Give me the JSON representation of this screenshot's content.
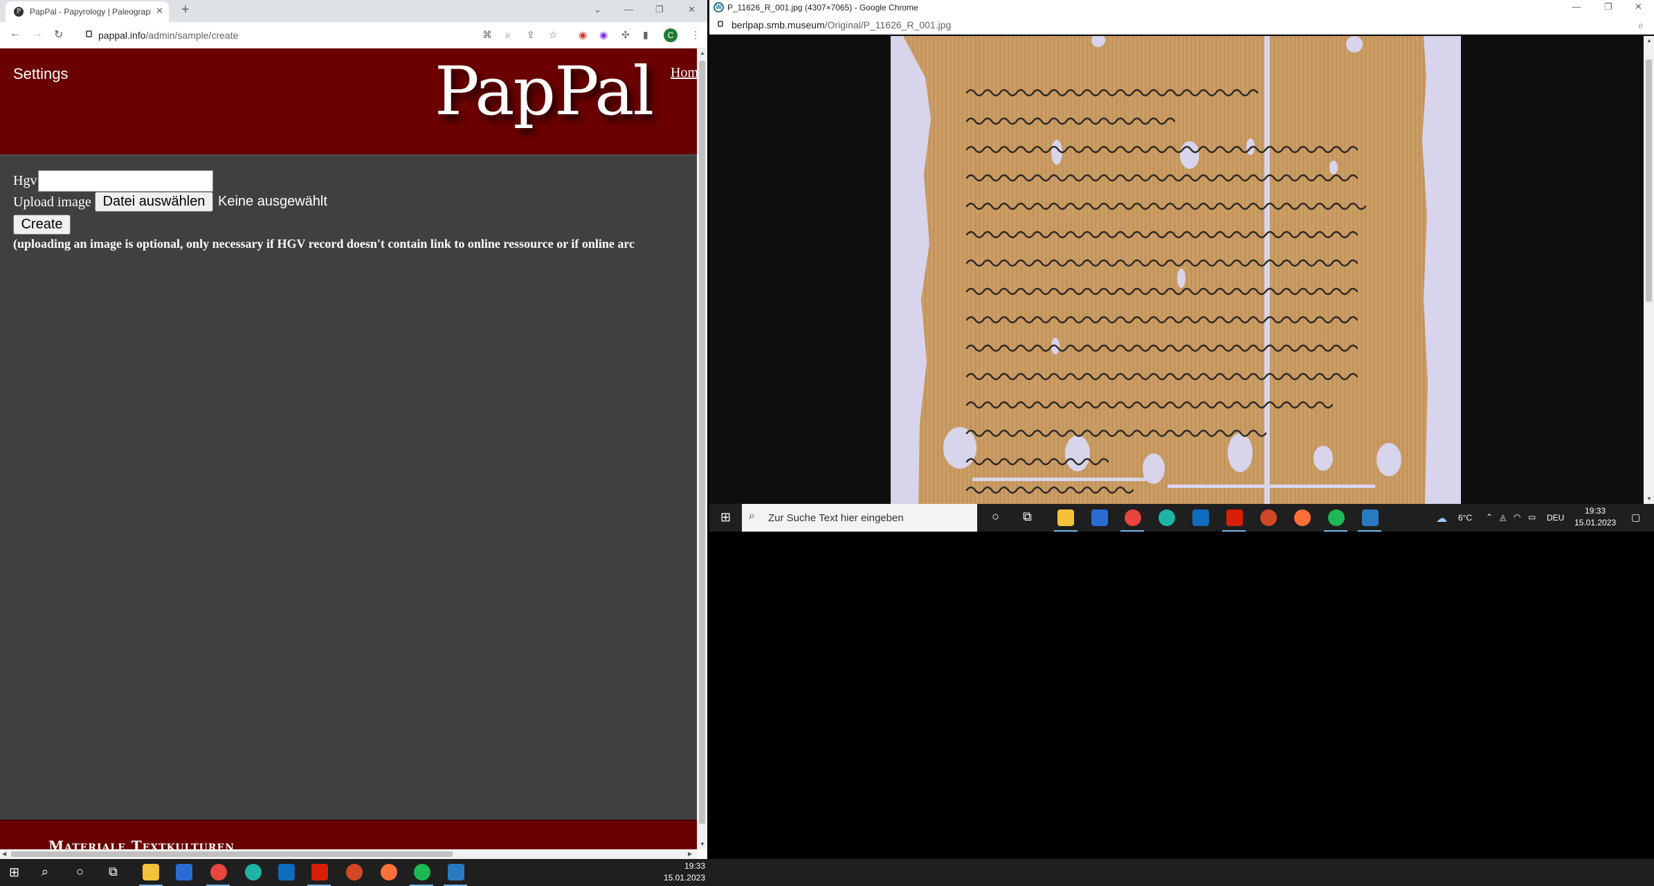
{
  "left_browser": {
    "tab_title": "PapPal - Papyrology | Paleograph",
    "favicon_letter": "P",
    "url_host": "pappal.info",
    "url_path": "/admin/sample/create",
    "profile_initial": "C"
  },
  "pappal": {
    "settings_link": "Settings",
    "logo": "PapPal",
    "home_link": "Hom",
    "hgv_label": "Hgv",
    "hgv_value": "",
    "upload_label": "Upload image",
    "choose_file_label": "Datei auswählen",
    "no_file_label": "Keine ausgewählt",
    "create_label": "Create",
    "note": "(uploading an image is optional, only necessary if HGV record doesn't contain link to online ressource or if online arc",
    "footer_text": "Materiale Textkulturen"
  },
  "right_browser": {
    "title": "P_11626_R_001.jpg (4307×7065) - Google Chrome",
    "url_host": "berlpap.smb.museum",
    "url_path": "/Original/P_11626_R_001.jpg"
  },
  "right_taskbar": {
    "search_placeholder": "Zur Suche Text hier eingeben",
    "weather": "6°C",
    "language": "DEU",
    "time": "19:33",
    "date": "15.01.2023"
  },
  "main_taskbar": {
    "time": "19:33",
    "date": "15.01.2023"
  },
  "colors": {
    "pappal_red": "#6b0000",
    "page_gray": "#404040",
    "papyrus": "#c89a62"
  }
}
